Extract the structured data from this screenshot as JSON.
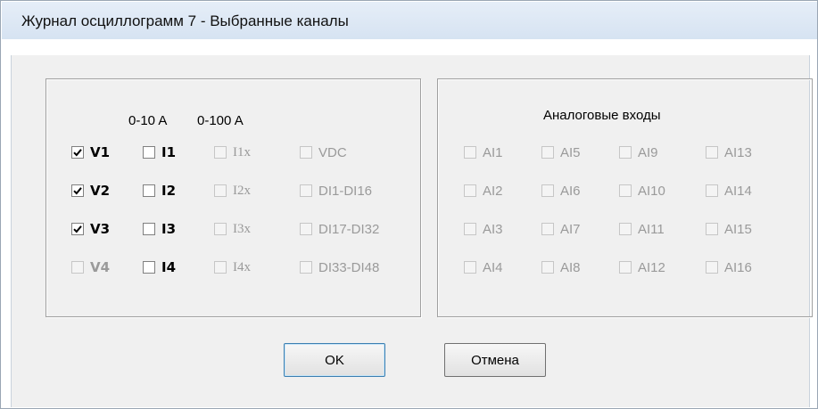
{
  "window": {
    "title": "Журнал осциллограмм 7 - Выбранные каналы"
  },
  "left_group": {
    "header_0_10": "0-10 A",
    "header_0_100": "0-100 A",
    "rows": [
      [
        {
          "label": "V1",
          "checked": true,
          "enabled": true
        },
        {
          "label": "I1",
          "checked": false,
          "enabled": true
        },
        {
          "label": "I1x",
          "checked": false,
          "enabled": false
        },
        {
          "label": "VDC",
          "checked": false,
          "enabled": false
        }
      ],
      [
        {
          "label": "V2",
          "checked": true,
          "enabled": true
        },
        {
          "label": "I2",
          "checked": false,
          "enabled": true
        },
        {
          "label": "I2x",
          "checked": false,
          "enabled": false
        },
        {
          "label": "DI1-DI16",
          "checked": false,
          "enabled": false
        }
      ],
      [
        {
          "label": "V3",
          "checked": true,
          "enabled": true
        },
        {
          "label": "I3",
          "checked": false,
          "enabled": true
        },
        {
          "label": "I3x",
          "checked": false,
          "enabled": false
        },
        {
          "label": "DI17-DI32",
          "checked": false,
          "enabled": false
        }
      ],
      [
        {
          "label": "V4",
          "checked": false,
          "enabled": false
        },
        {
          "label": "I4",
          "checked": false,
          "enabled": true
        },
        {
          "label": "I4x",
          "checked": false,
          "enabled": false
        },
        {
          "label": "DI33-DI48",
          "checked": false,
          "enabled": false
        }
      ]
    ]
  },
  "right_group": {
    "title": "Аналоговые входы",
    "rows": [
      [
        {
          "label": "AI1",
          "checked": false,
          "enabled": false
        },
        {
          "label": "AI5",
          "checked": false,
          "enabled": false
        },
        {
          "label": "AI9",
          "checked": false,
          "enabled": false
        },
        {
          "label": "AI13",
          "checked": false,
          "enabled": false
        }
      ],
      [
        {
          "label": "AI2",
          "checked": false,
          "enabled": false
        },
        {
          "label": "AI6",
          "checked": false,
          "enabled": false
        },
        {
          "label": "AI10",
          "checked": false,
          "enabled": false
        },
        {
          "label": "AI14",
          "checked": false,
          "enabled": false
        }
      ],
      [
        {
          "label": "AI3",
          "checked": false,
          "enabled": false
        },
        {
          "label": "AI7",
          "checked": false,
          "enabled": false
        },
        {
          "label": "AI11",
          "checked": false,
          "enabled": false
        },
        {
          "label": "AI15",
          "checked": false,
          "enabled": false
        }
      ],
      [
        {
          "label": "AI4",
          "checked": false,
          "enabled": false
        },
        {
          "label": "AI8",
          "checked": false,
          "enabled": false
        },
        {
          "label": "AI12",
          "checked": false,
          "enabled": false
        },
        {
          "label": "AI16",
          "checked": false,
          "enabled": false
        }
      ]
    ]
  },
  "buttons": {
    "ok": "OK",
    "cancel": "Отмена"
  }
}
